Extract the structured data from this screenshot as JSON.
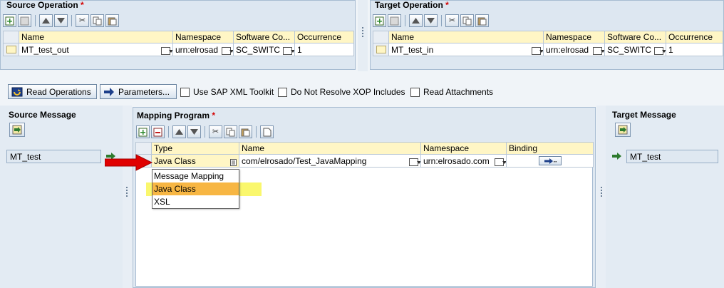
{
  "source_operation": {
    "title": "Source Operation",
    "required_mark": "*",
    "columns": [
      "Name",
      "Namespace",
      "Software Co...",
      "Occurrence"
    ],
    "row": {
      "name": "MT_test_out",
      "namespace": "urn:elrosad",
      "software": "SC_SWITC",
      "occurrence": "1"
    }
  },
  "target_operation": {
    "title": "Target Operation",
    "required_mark": "*",
    "columns": [
      "Name",
      "Namespace",
      "Software Co...",
      "Occurrence"
    ],
    "row": {
      "name": "MT_test_in",
      "namespace": "urn:elrosad",
      "software": "SC_SWITC",
      "occurrence": "1"
    }
  },
  "actions": {
    "read_operations": "Read Operations",
    "parameters": "Parameters...",
    "use_sap_xml": "Use SAP XML Toolkit",
    "no_xop": "Do Not Resolve XOP Includes",
    "read_attachments": "Read Attachments"
  },
  "source_message": {
    "title": "Source Message",
    "value": "MT_test"
  },
  "target_message": {
    "title": "Target Message",
    "value": "MT_test"
  },
  "mapping_program": {
    "title": "Mapping Program",
    "required_mark": "*",
    "columns": [
      "Type",
      "Name",
      "Namespace",
      "Binding"
    ],
    "row": {
      "type": "Java Class",
      "name": "com/elrosado/Test_JavaMapping",
      "namespace": "urn:elrosado.com"
    },
    "dropdown": [
      "Message Mapping",
      "Java Class",
      "XSL"
    ],
    "dropdown_selected": "Java Class"
  },
  "colors": {
    "header_yellow": "#fff6c5",
    "panel_blue": "#dde7f1",
    "selected_orange": "#f7b643",
    "annotation_red": "#e00000",
    "annotation_yellow": "#f8f43c"
  },
  "icons": [
    "create-row-icon",
    "delete-row-icon",
    "move-up-icon",
    "move-down-icon",
    "cut-icon",
    "copy-icon",
    "paste-icon",
    "insert-icon",
    "read-operations-icon",
    "parameters-arrow-icon",
    "binding-arrow-icon",
    "message-link-icon"
  ]
}
